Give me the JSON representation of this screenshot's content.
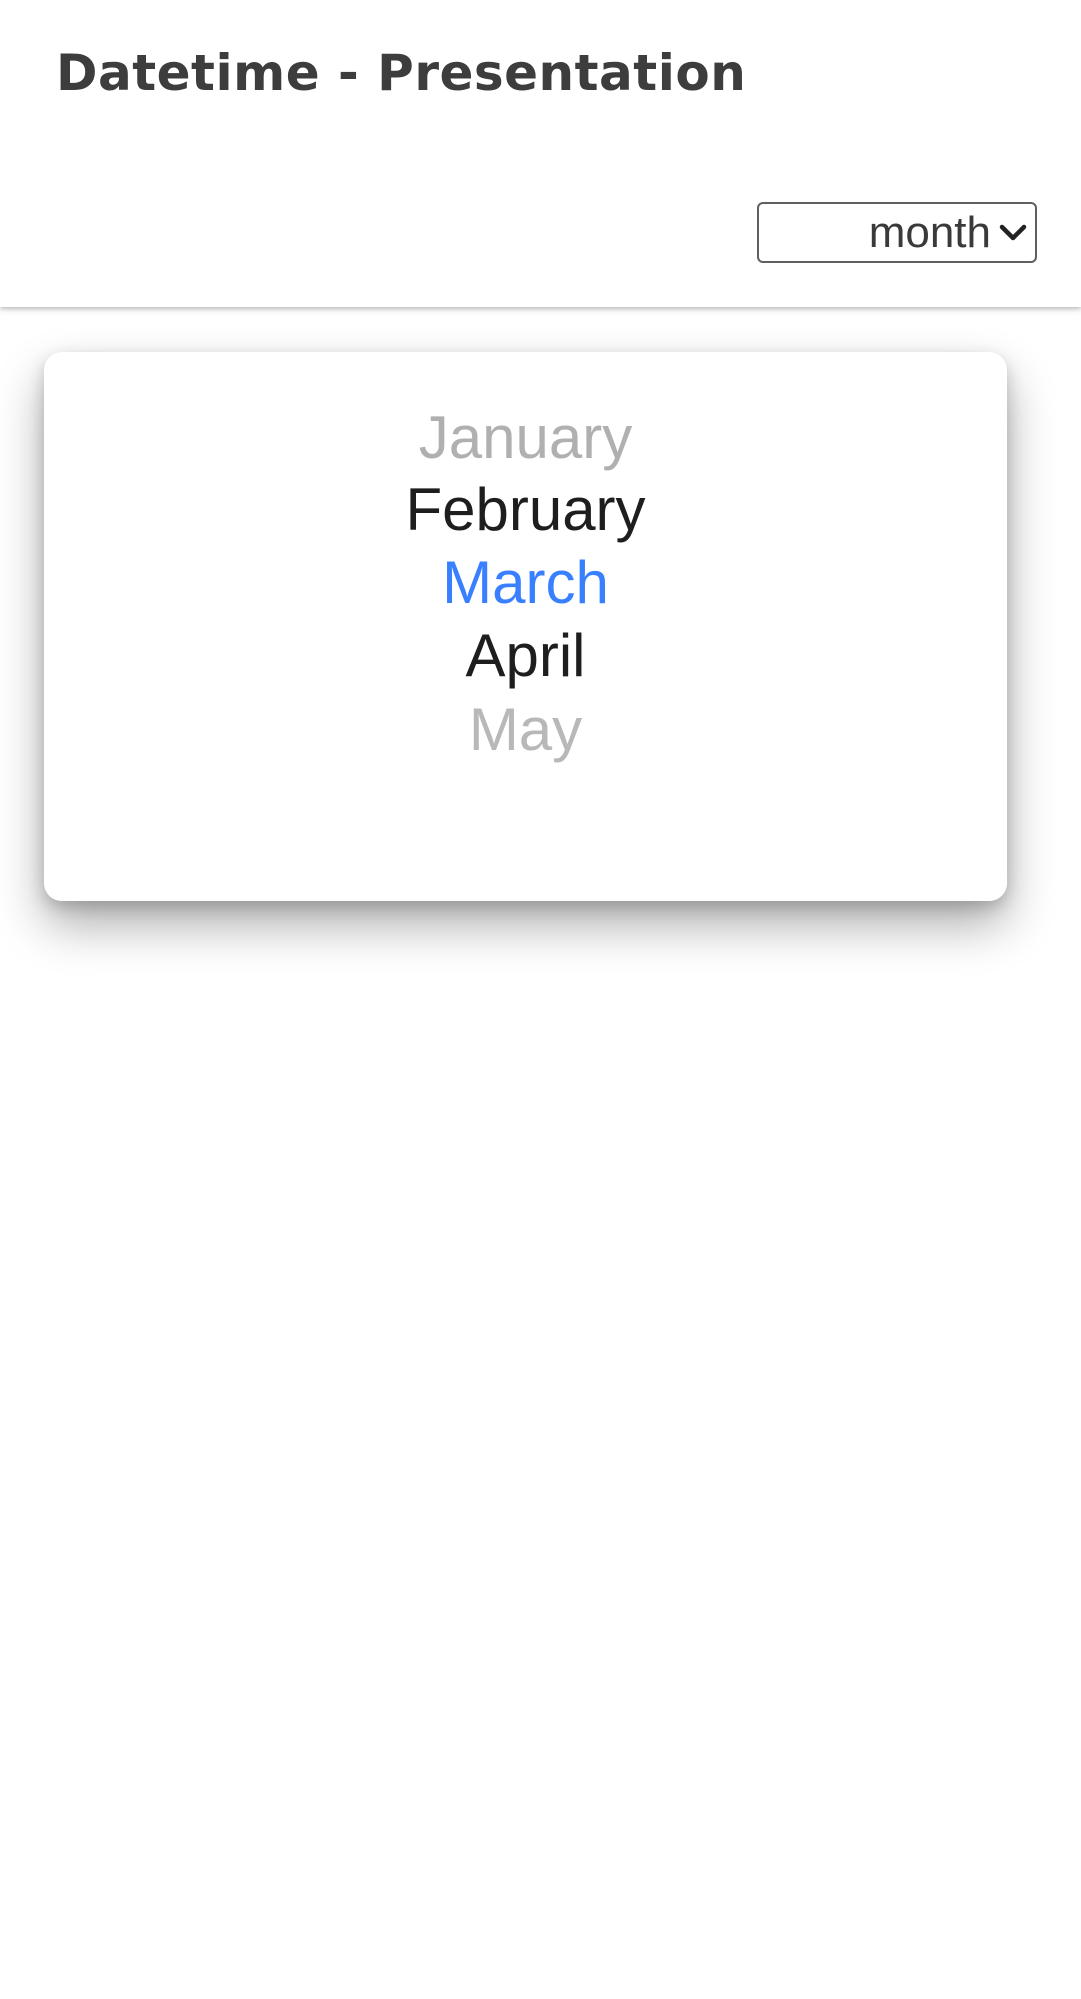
{
  "header": {
    "title": "Datetime - Presentation",
    "presentation_select": {
      "selected": "month"
    }
  },
  "picker": {
    "accent_color": "#3880ff",
    "items": [
      {
        "label": "January",
        "state": "faded"
      },
      {
        "label": "February",
        "state": "normal"
      },
      {
        "label": "March",
        "state": "selected"
      },
      {
        "label": "April",
        "state": "normal"
      },
      {
        "label": "May",
        "state": "faded"
      }
    ]
  },
  "icons": {
    "select_arrow": "chevron-down-icon"
  }
}
